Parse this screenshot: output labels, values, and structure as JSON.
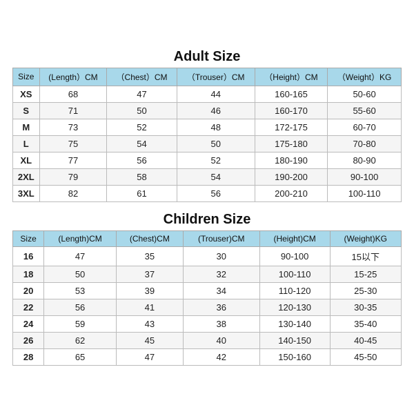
{
  "adult": {
    "title": "Adult Size",
    "headers": [
      "Size",
      "(Length）CM",
      "（Chest）CM",
      "（Trouser）CM",
      "（Height）CM",
      "（Weight）KG"
    ],
    "rows": [
      [
        "XS",
        "68",
        "47",
        "44",
        "160-165",
        "50-60"
      ],
      [
        "S",
        "71",
        "50",
        "46",
        "160-170",
        "55-60"
      ],
      [
        "M",
        "73",
        "52",
        "48",
        "172-175",
        "60-70"
      ],
      [
        "L",
        "75",
        "54",
        "50",
        "175-180",
        "70-80"
      ],
      [
        "XL",
        "77",
        "56",
        "52",
        "180-190",
        "80-90"
      ],
      [
        "2XL",
        "79",
        "58",
        "54",
        "190-200",
        "90-100"
      ],
      [
        "3XL",
        "82",
        "61",
        "56",
        "200-210",
        "100-110"
      ]
    ]
  },
  "children": {
    "title": "Children Size",
    "headers": [
      "Size",
      "(Length)CM",
      "(Chest)CM",
      "(Trouser)CM",
      "(Height)CM",
      "(Weight)KG"
    ],
    "rows": [
      [
        "16",
        "47",
        "35",
        "30",
        "90-100",
        "15以下"
      ],
      [
        "18",
        "50",
        "37",
        "32",
        "100-110",
        "15-25"
      ],
      [
        "20",
        "53",
        "39",
        "34",
        "110-120",
        "25-30"
      ],
      [
        "22",
        "56",
        "41",
        "36",
        "120-130",
        "30-35"
      ],
      [
        "24",
        "59",
        "43",
        "38",
        "130-140",
        "35-40"
      ],
      [
        "26",
        "62",
        "45",
        "40",
        "140-150",
        "40-45"
      ],
      [
        "28",
        "65",
        "47",
        "42",
        "150-160",
        "45-50"
      ]
    ]
  }
}
